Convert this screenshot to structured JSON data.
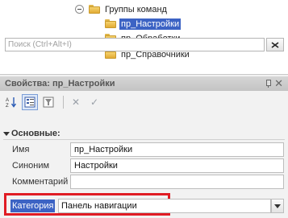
{
  "tree": {
    "group_label": "Группы команд",
    "items": [
      {
        "label": "пр_Настройки",
        "selected": true
      },
      {
        "label": "пр_Обработки",
        "selected": false
      },
      {
        "label": "пр_Справочники",
        "selected": false
      }
    ]
  },
  "properties": {
    "title": "Свойства: пр_Настройки",
    "close_glyph": "✕",
    "search_placeholder": "Поиск (Ctrl+Alt+I)",
    "section_label": "Основные:",
    "fields": {
      "name_label": "Имя",
      "name_value": "пр_Настройки",
      "synonym_label": "Синоним",
      "synonym_value": "Настройки",
      "comment_label": "Комментарий",
      "comment_value": ""
    },
    "category": {
      "label": "Категория",
      "value": "Панель навигации"
    }
  },
  "colors": {
    "selection": "#3c63c4",
    "highlight_frame": "#e01c24"
  }
}
